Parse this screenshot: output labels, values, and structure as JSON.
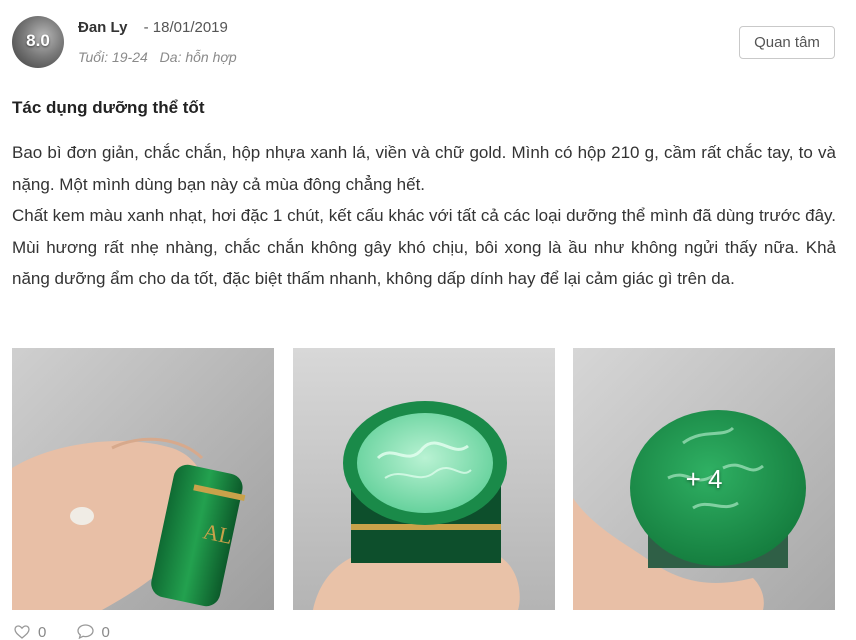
{
  "reviewer": {
    "score": "8.0",
    "name": "Đan Ly",
    "date": "- 18/01/2019",
    "age": "Tuổi: 19-24",
    "skin_type": "Da: hỗn hợp"
  },
  "follow_button": "Quan tâm",
  "review": {
    "title": "Tác dụng dưỡng thể tốt",
    "paragraphs": [
      "Bao bì đơn giản, chắc chắn, hộp nhựa xanh lá, viền và chữ gold. Mình có hộp 210 g, cầm rất chắc tay, to và nặng. Một mình dùng bạn này cả mùa đông chẳng hết.",
      "Chất kem màu xanh nhạt, hơi đặc 1 chút, kết cấu khác với tất cả các loại dưỡng thể mình đã dùng trước đây. Mùi hương rất nhẹ nhàng, chắc chắn không gây khó chịu, bôi xong là ầu như không ngửi thấy nữa. Khả năng dưỡng ẩm cho da tốt, đặc biệt thấm nhanh, không dấp dính hay để lại cảm giác gì trên da."
    ]
  },
  "photos": {
    "more_label": "+ 4"
  },
  "actions": {
    "likes": "0",
    "comments": "0"
  },
  "colors": {
    "jar_green": "#1f8f4e",
    "cream_green": "#7fe0b0",
    "gold": "#c9a24a"
  }
}
